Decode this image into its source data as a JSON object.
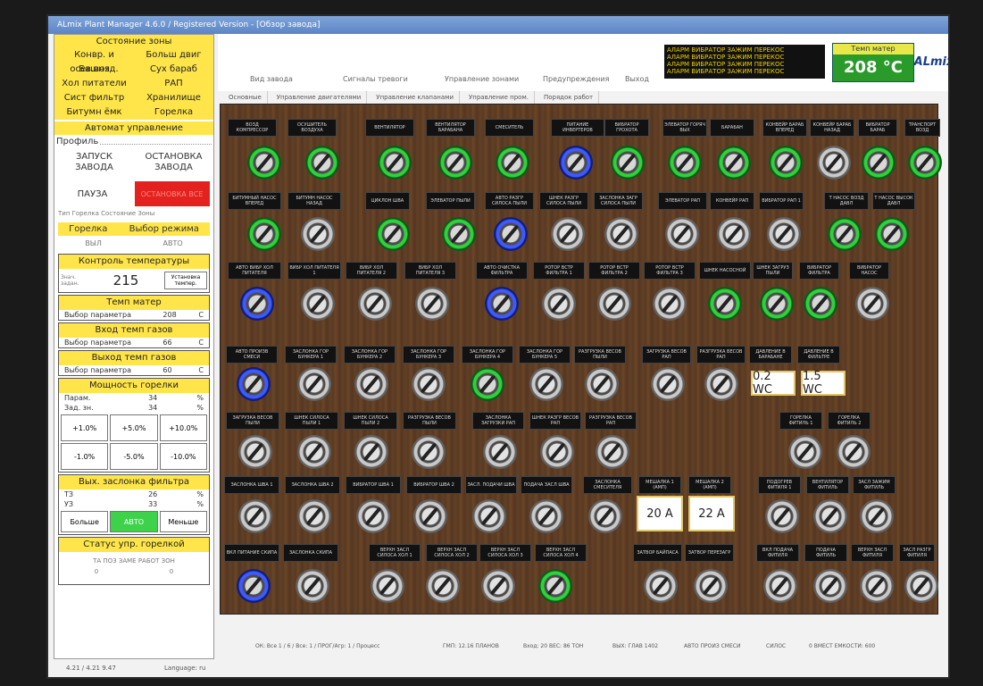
{
  "window": {
    "title": "ALmix Plant Manager 4.6.0 / Registered Version - [Обзор завода]"
  },
  "left": {
    "zone_state_header": "Состояние зоны",
    "zone_items": [
      "Конвр. и осев.возд.",
      "Больш двиг",
      "Башня",
      "Сух бараб",
      "Хол питатели",
      "РАП",
      "Сист фильтр",
      "Хранилище",
      "Битумн ёмк",
      "Горелка"
    ],
    "auto_header": "Автомат управление",
    "profile_label": "Профиль",
    "start": "ЗАПУСК ЗАВОДА",
    "stop": "ОСТАНОВКА ЗАВОДА",
    "pause": "ПАУЗА",
    "emergency": "ОСТАНОВКА ВСЕ",
    "small_line": "Тип   Горелка   Состояние   Зоны",
    "burner_label": "Горелка",
    "mode_label": "Выбор режима",
    "burner_state": "ВЫЛ",
    "mode_state": "АВТО",
    "temp_ctrl_header": "Контроль температуры",
    "temp_set_label": "Знач. задан.",
    "temp_set_value": "215",
    "temp_set_button": "Установка темпер.",
    "mat_temp_header": "Темп матер",
    "mat_temp_label": "Выбор параметра",
    "mat_temp_value": "208",
    "mat_temp_unit": "C",
    "gas_in_header": "Вход темп газов",
    "gas_in_label": "Выбор параметра",
    "gas_in_value": "66",
    "gas_in_unit": "C",
    "gas_out_header": "Выход темп газов",
    "gas_out_label": "Выбор параметра",
    "gas_out_value": "60",
    "gas_out_unit": "C",
    "burner_power_header": "Мощность горелки",
    "burner_param_label": "Парам.",
    "burner_param_value": "34",
    "burner_set_label": "Зад. зн.",
    "burner_set_value": "34",
    "percent": "%",
    "steps_pos": [
      "+1.0%",
      "+5.0%",
      "+10.0%"
    ],
    "steps_neg": [
      "-1.0%",
      "-5.0%",
      "-10.0%"
    ],
    "filter_header": "Вых. заслонка фильтра",
    "filter_t3_label": "ТЗ",
    "filter_t3_value": "26",
    "filter_u3_label": "УЗ",
    "filter_u3_value": "33",
    "more_btn": "Больше",
    "auto_btn": "АВТО",
    "less_btn": "Меньше",
    "burner_status_header": "Статус упр. горелкой",
    "burner_status_text": "ТА ПОЗ ЗАМЕ РАБОТ ЗОН",
    "burner_status_v1": "0",
    "burner_status_v2": "0"
  },
  "nav": {
    "items": [
      "Вид завода",
      "Сигналы тревоги",
      "Управление зонами",
      "Предупреждения",
      "Выход"
    ],
    "ticker": [
      "АЛАРМ ВИБРАТОР ЗАЖИМ ПЕРЕКОС",
      "АЛАРМ ВИБРАТОР ЗАЖИМ ПЕРЕКОС",
      "АЛАРМ ВИБРАТОР ЗАЖИМ ПЕРЕКОС",
      "АЛАРМ ВИБРАТОР ЗАЖИМ ПЕРЕКОС"
    ],
    "temp_label": "Темп матер",
    "temp_value": "208 °C",
    "logo": "ALmix"
  },
  "tabs": [
    "Основные",
    "Управление двигателями",
    "Управление клапанами",
    "Управление пром.",
    "Порядок работ"
  ],
  "panel": {
    "labels": [
      "ВОЗД КОМПРЕССОР",
      "ОСУШИТЕЛЬ ВОЗДУХА",
      "ВЕНТИЛЯТОР",
      "ВЕНТИЛЯТОР БАРАБАНА",
      "СМЕСИТЕЛЬ",
      "ПИТАНИЕ ИНВЕРТЕРОВ",
      "ВИБРАТОР ГРОХОТА",
      "ЭЛЕВАТОР ГОРЯЧ ВЫХ",
      "БАРАБАН",
      "КОНВЕЙР БАРАБ ВПЕРЕД",
      "КОНВЕЙР БАРАБ НАЗАД",
      "ВИБРАТОР БАРАБ",
      "ТРАНСПОРТ ВОЗД",
      "БИТУМНЫЙ НАСОС ВПЕРЕД",
      "БИТУМН НАСОС НАЗАД",
      "ЦИКЛОН ШВА",
      "ЭЛЕВАТОР ПЫЛИ",
      "АВТО РАЗГР СИЛОСА ПЫЛИ",
      "ШНЕК РАЗГР СИЛОСА ПЫЛИ",
      "ЗАСЛОНКА ЗАГР СИЛОСА ПЫЛИ",
      "ЭЛЕВАТОР РАП",
      "КОНВЕЙР РАП",
      "ВИБРАТОР РАП 1",
      "Т НАСОС ВОЗД ДАВЛ",
      "Т НАСОС ВЫСОК ДАВЛ",
      "АВТО ВИБР ХОЛ ПИТАТЕЛЯ",
      "ВИБР ХОЛ ПИТАТЕЛЯ 1",
      "ВИБР ХОЛ ПИТАТЕЛЯ 2",
      "ВИБР ХОЛ ПИТАТЕЛЯ 3",
      "АВТО ОЧИСТКА ФИЛЬТРА",
      "РОТОР ВСТР ФИЛЬТРА 1",
      "РОТОР ВСТР ФИЛЬТРА 2",
      "РОТОР ВСТР ФИЛЬТРА 3",
      "ШНЕК НАСОСНОЙ",
      "ШНЕК ЗАГРУЗ ПЫЛИ",
      "ВИБРАТОР ФИЛЬТРА",
      "ВИБРАТОР НАСОС",
      "АВТО ПРОИЗВ СМЕСИ",
      "ЗАСЛОНКА ГОР БУНКЕРА 1",
      "ЗАСЛОНКА ГОР БУНКЕРА 2",
      "ЗАСЛОНКА ГОР БУНКЕРА 3",
      "ЗАСЛОНКА ГОР БУНКЕРА 4",
      "ЗАСЛОНКА ГОР БУНКЕРА 5",
      "РАЗГРУЗКА ВЕСОВ ПЫЛИ",
      "ЗАГРУЗКА ВЕСОВ РАП",
      "РАЗГРУЗКА ВЕСОВ РАП",
      "ДАВЛЕНИЕ В БАРАБАНЕ",
      "ДАВЛЕНИЕ В ФИЛЬТРЕ",
      "ЗАГРУЗКА ВЕСОВ ПЫЛИ",
      "ШНЕК СИЛОСА ПЫЛИ 1",
      "ШНЕК СИЛОСА ПЫЛИ 2",
      "РАЗГРУЗКА ВЕСОВ ПЫЛИ",
      "ЗАСЛОНКА ЗАГРУЗКИ РАП",
      "ШНЕК РАЗГР ВЕСОВ РАП",
      "РАЗГРУЗКА ВЕСОВ РАП",
      "ГОРЕЛКА ФИТИЛЬ 1",
      "ГОРЕЛКА ФИТИЛЬ 2",
      "ЗАСЛОНКА ШВА 1",
      "ЗАСЛОНКА ШВА 2",
      "ВИБРАТОР ШВА 1",
      "ВИБРАТОР ШВА 2",
      "ЗАСЛ. ПОДАЧИ ШВА",
      "ПОДАЧА ЗАСЛ ШВА",
      "ЗАСЛОНКА СМЕСИТЕЛЯ",
      "МЕШАЛКА 1 (АМП)",
      "МЕШАЛКА 2 (АМП)",
      "ПОДОГРЕВ ФИТИЛЯ 1",
      "ВЕНТИЛЯТОР ФИТИЛЬ",
      "ЗАСЛ ЗАЖИМ ФИТИЛЬ",
      "ВКЛ ПИТАНИЕ СКИПА",
      "ЗАСЛОНКА СКИПА",
      "ВЕРХН ЗАСЛ СИЛОСА ХОЛ 1",
      "ВЕРХН ЗАСЛ СИЛОСА ХОЛ 2",
      "ВЕРХН ЗАСЛ СИЛОСА ХОЛ 3",
      "ВЕРХН ЗАСЛ СИЛОСА ХОЛ 4",
      "ЗАТВОР БАЙПАСА",
      "ЗАТВОР ПЕРЕЗАГР",
      "ВКЛ ПОДАЧА ФИТИЛЯ",
      "ПОДАЧА ФИТИЛЬ",
      "ВЕРХН ЗАСЛ ФИТИЛЯ",
      "ЗАСЛ РАЗГР ФИТИЛЯ"
    ],
    "pressure_drum": "0.2 WC",
    "pressure_filter": "1.5 WC",
    "mixer_amp_1": "20 A",
    "mixer_amp_2": "22 A"
  },
  "status": {
    "items": [
      "ОК: Все 1 / 6 / Все: 1 / ПРОГ/Агр: 1 / Процесс",
      "ГМП: 12.16 ПЛАНОВ",
      "Вход: 20 ВЕС: 86 ТОН",
      "ВЫХ: ГЛАВ 1402",
      "АВТО ПРОИЗ СМЕСИ",
      "СИЛОС",
      "0 ВМЕСТ ЕМКОСТИ: 600"
    ],
    "bottom_left": "4.21 / 4.21 9.47",
    "bottom_lang": "Language:  ru"
  }
}
